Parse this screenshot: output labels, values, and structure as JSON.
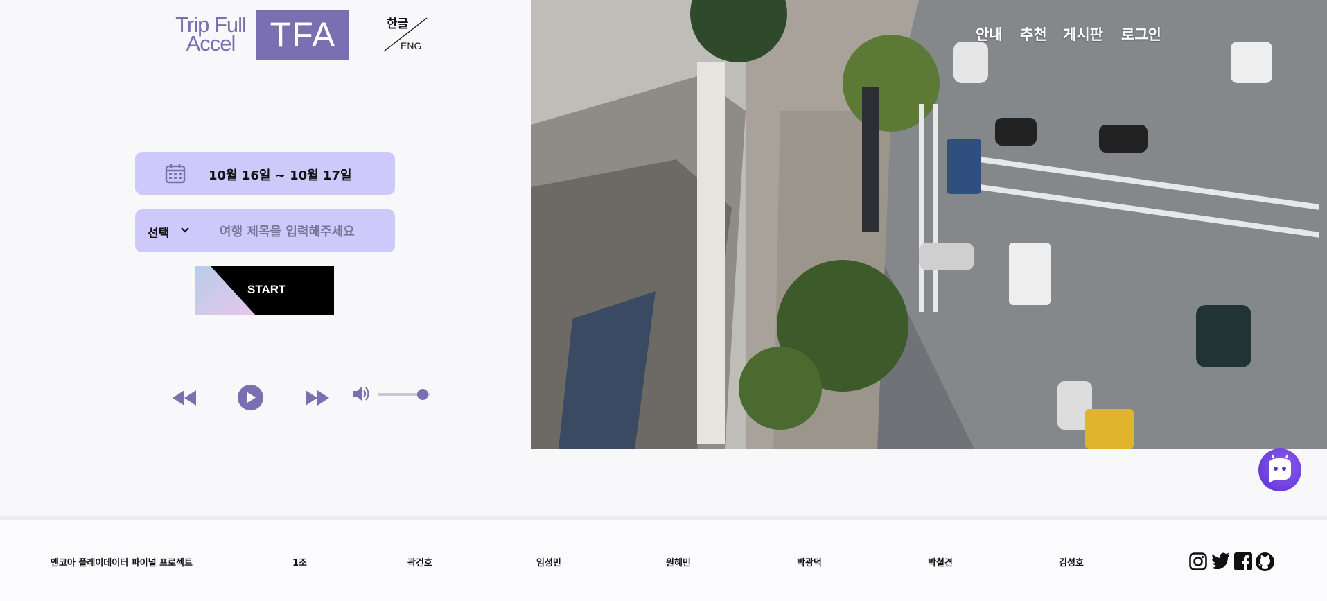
{
  "brand": {
    "logo_text_line1": "Trip Full",
    "logo_text_line2": "Accel",
    "logo_box_text": "TFA"
  },
  "language": {
    "korean": "한글",
    "english": "ENG"
  },
  "trip": {
    "date_range": "10월 16일 ~ 10월 17일",
    "select_value": "선택",
    "title_placeholder": "여행 제목을 입력해주세요",
    "start_label": "START"
  },
  "player": {
    "volume_level": 0.85
  },
  "nav": {
    "items": [
      "안내",
      "추천",
      "게시판",
      "로그인"
    ]
  },
  "footer": {
    "project": "엔코아 플레이데이터 파이널 프로젝트",
    "team": "1조",
    "members": [
      "곽건호",
      "임성민",
      "원혜민",
      "박광덕",
      "박철견",
      "김성호"
    ]
  },
  "social_icons": [
    "instagram-icon",
    "twitter-icon",
    "facebook-icon",
    "github-icon"
  ],
  "colors": {
    "accent": "#7a6fb0",
    "box_fill": "#cdc9fb",
    "chatbot": "#6a3be0"
  }
}
